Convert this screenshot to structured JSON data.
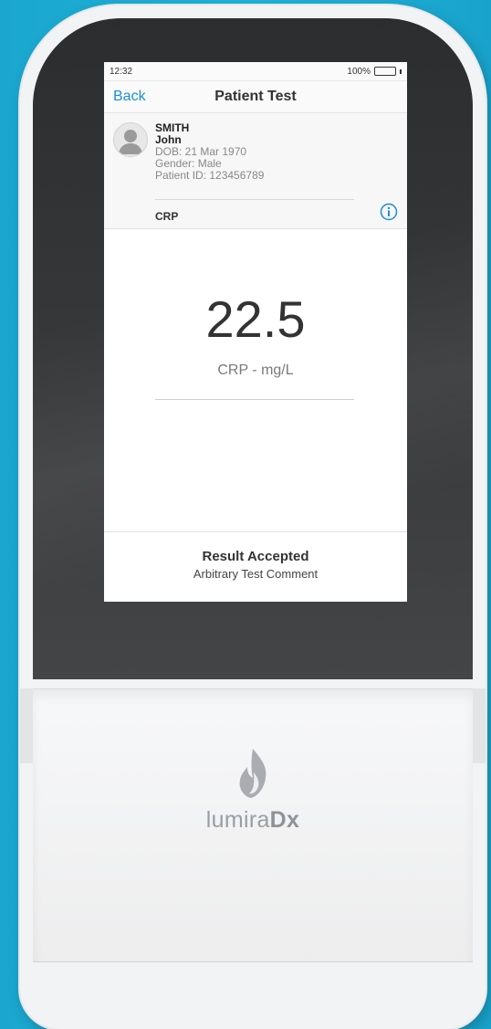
{
  "status_bar": {
    "time": "12:32",
    "battery": "100%"
  },
  "nav": {
    "back_label": "Back",
    "title": "Patient Test"
  },
  "patient": {
    "surname": "SMITH",
    "first_name": "John",
    "dob": "DOB: 21 Mar 1970",
    "gender": "Gender: Male",
    "patient_id": "Patient ID: 123456789",
    "test": "CRP"
  },
  "result": {
    "value": "22.5",
    "unit": "CRP - mg/L"
  },
  "footer": {
    "status": "Result Accepted",
    "comment": "Arbitrary Test Comment"
  },
  "brand": {
    "name_light": "lumira",
    "name_bold": "Dx"
  },
  "colors": {
    "accent": "#1a8fd6",
    "background": "#1fb3da"
  },
  "icons": {
    "info": "info-circle-icon",
    "avatar": "user-silhouette-icon",
    "logo": "flame-icon"
  }
}
